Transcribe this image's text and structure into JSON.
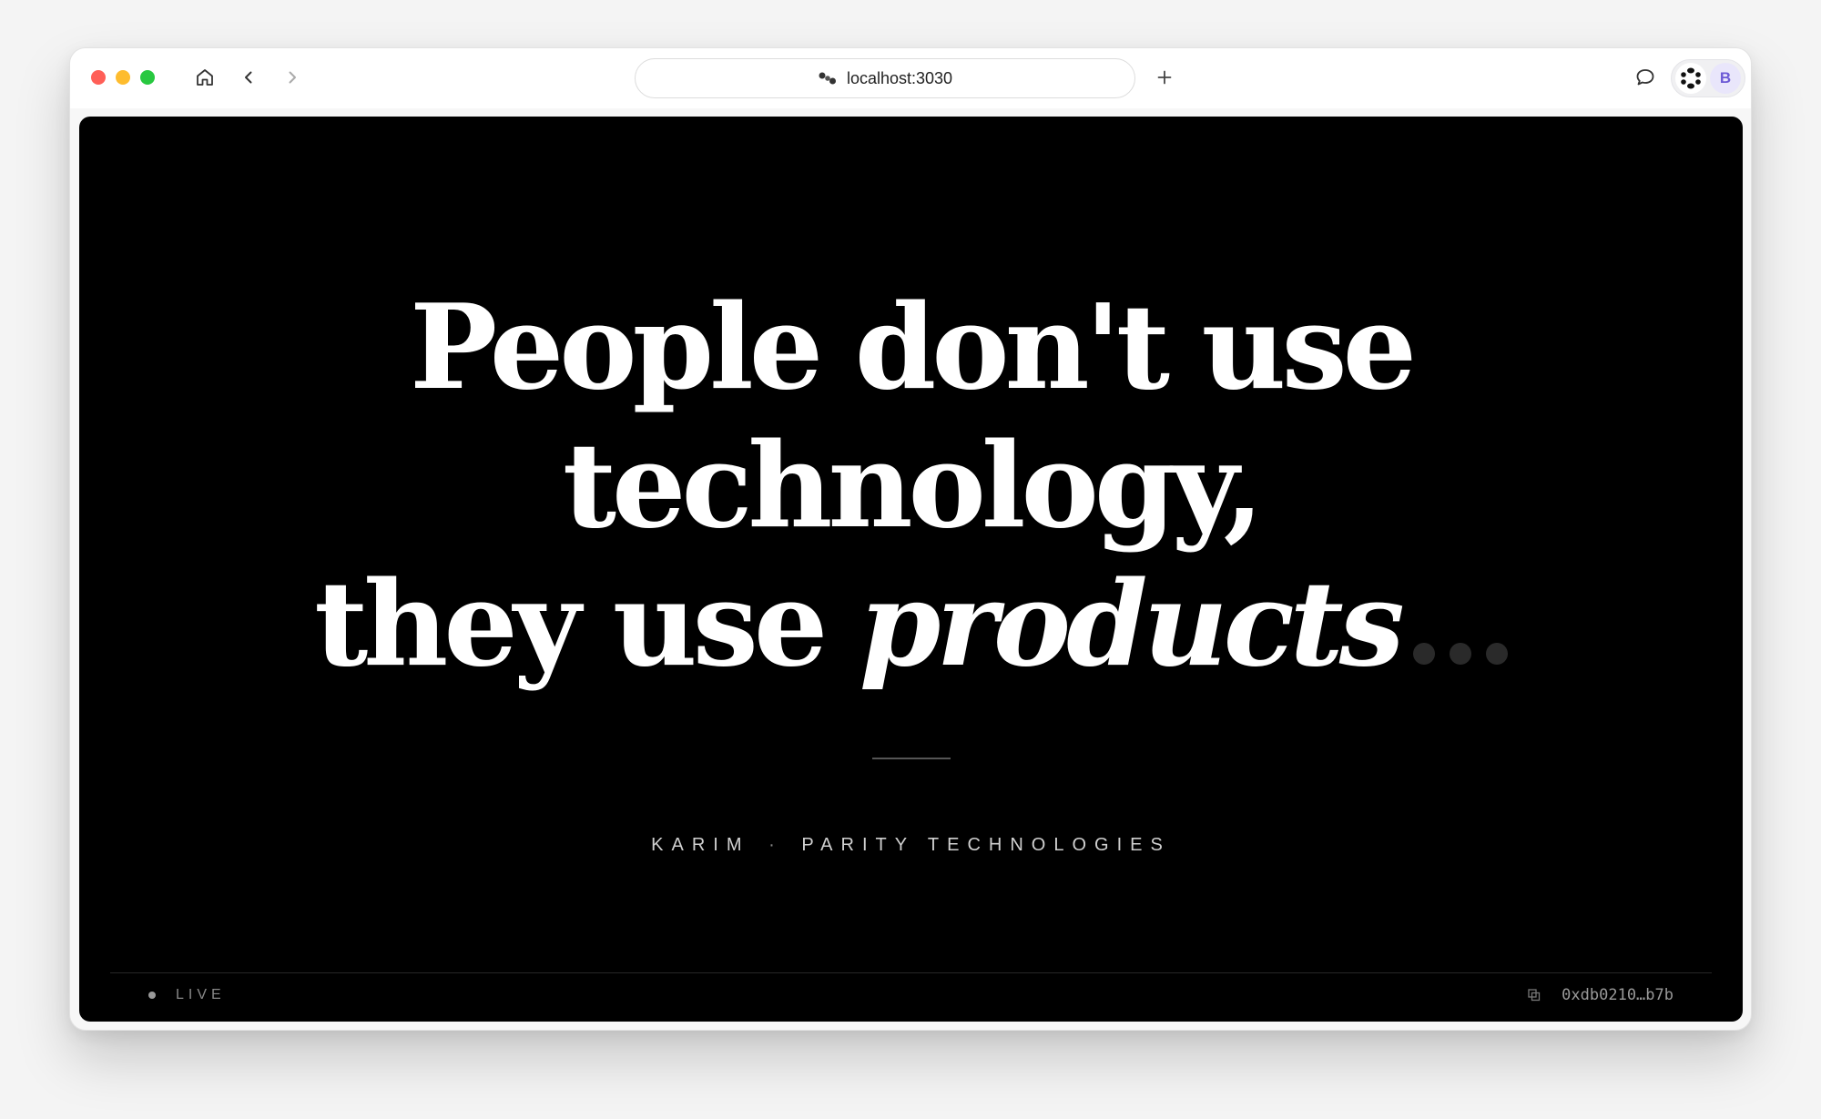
{
  "browser": {
    "url": "localhost:3030",
    "avatar_letter": "B",
    "icons": {
      "home": "home-icon",
      "back": "chevron-left-icon",
      "forward": "chevron-right-icon",
      "site": "site-identity-icon",
      "new_tab": "plus-icon",
      "chat": "chat-bubble-icon",
      "extension": "dots-ring-icon"
    }
  },
  "hero": {
    "line1": "People don't use",
    "line2": "technology,",
    "line3_prefix": "they use ",
    "line3_emphasis": "products"
  },
  "attribution": {
    "name": "KARIM",
    "separator": "·",
    "company": "PARITY TECHNOLOGIES"
  },
  "footer": {
    "status": "LIVE",
    "address": "0xdb0210…b7b",
    "copy_icon": "copy-icon"
  },
  "colors": {
    "background": "#000000",
    "text": "#ffffff",
    "avatar_accent": "#6d5bd6"
  }
}
